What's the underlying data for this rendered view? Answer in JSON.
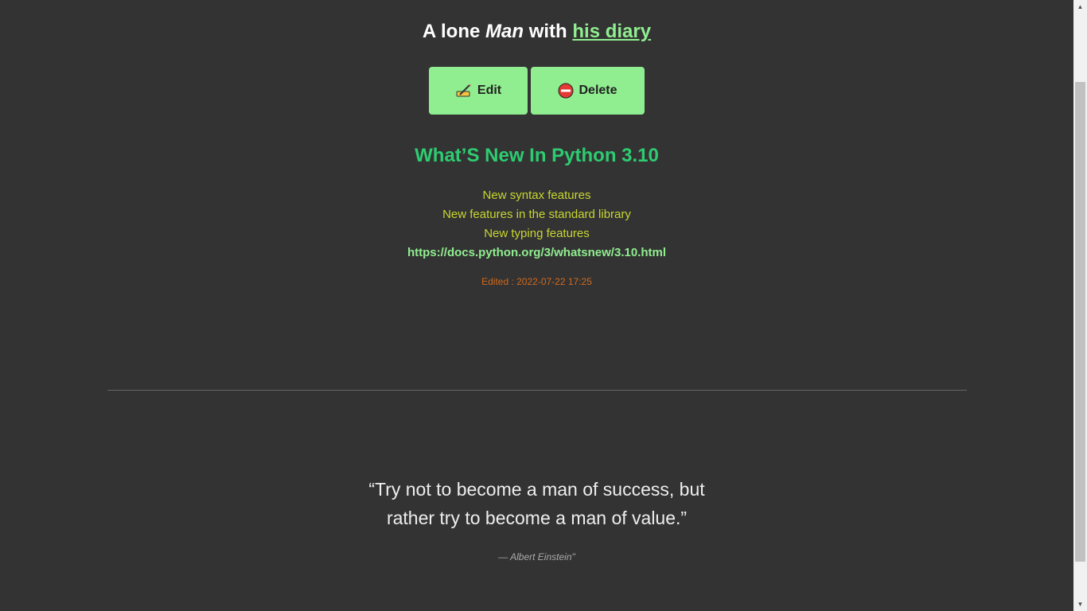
{
  "header": {
    "part1": "A lone ",
    "part2": "Man",
    "part3": " with ",
    "link": "his diary"
  },
  "actions": {
    "edit_label": "Edit",
    "delete_label": "Delete"
  },
  "post": {
    "title": "What’S New In Python 3.10",
    "lines": [
      "New syntax features",
      "New features in the standard library",
      "New typing features"
    ],
    "link": "https://docs.python.org/3/whatsnew/3.10.html",
    "edited": "Edited : 2022-07-22 17:25"
  },
  "quote": {
    "line1": "“Try not to become a man of success, but",
    "line2": "rather try to become a man of value.”",
    "author": "— Albert Einstein\""
  },
  "colors": {
    "background": "#333333",
    "accent": "#90ee90",
    "title": "#2ecc71",
    "body_text": "#c8d630",
    "edited": "#d2691e"
  },
  "icons": {
    "edit": "writing-hand-icon",
    "delete": "no-entry-icon"
  }
}
